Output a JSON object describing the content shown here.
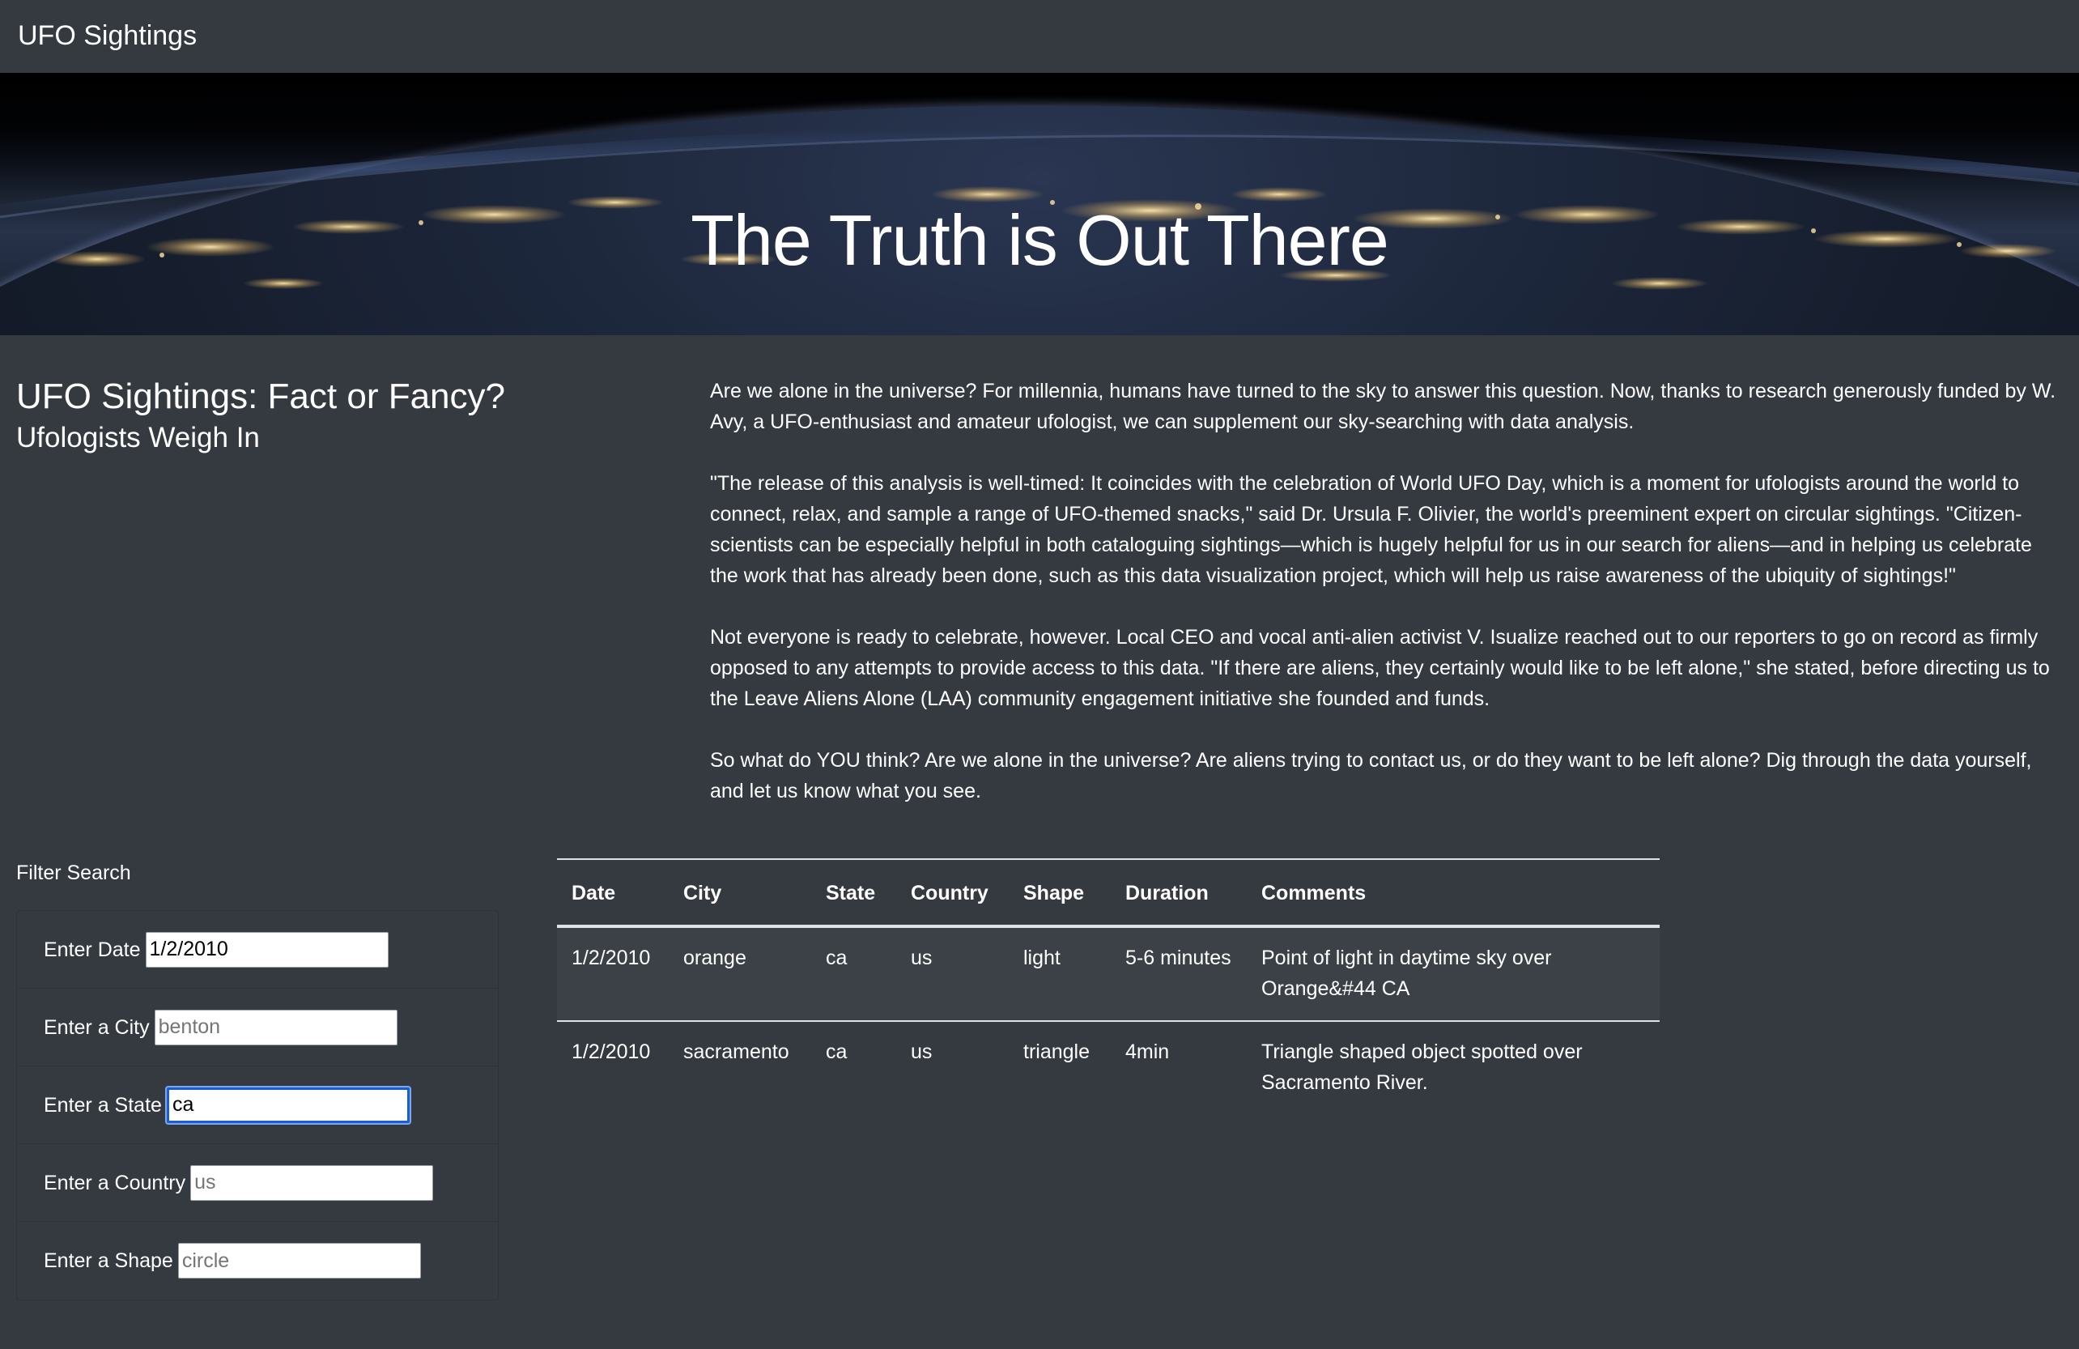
{
  "navbar": {
    "brand": "UFO Sightings"
  },
  "hero": {
    "title": "The Truth is Out There"
  },
  "intro": {
    "title": "UFO Sightings: Fact or Fancy?",
    "subtitle": "Ufologists Weigh In"
  },
  "article": {
    "paragraphs": [
      "Are we alone in the universe? For millennia, humans have turned to the sky to answer this question. Now, thanks to research generously funded by W. Avy, a UFO-enthusiast and amateur ufologist, we can supplement our sky-searching with data analysis.",
      "\"The release of this analysis is well-timed: It coincides with the celebration of World UFO Day, which is a moment for ufologists around the world to connect, relax, and sample a range of UFO-themed snacks,\" said Dr. Ursula F. Olivier, the world's preeminent expert on circular sightings. \"Citizen-scientists can be especially helpful in both cataloguing sightings—which is hugely helpful for us in our search for aliens—and in helping us celebrate the work that has already been done, such as this data visualization project, which will help us raise awareness of the ubiquity of sightings!\"",
      "Not everyone is ready to celebrate, however. Local CEO and vocal anti-alien activist V. Isualize reached out to our reporters to go on record as firmly opposed to any attempts to provide access to this data. \"If there are aliens, they certainly would like to be left alone,\" she stated, before directing us to the Leave Aliens Alone (LAA) community engagement initiative she founded and funds.",
      "So what do YOU think? Are we alone in the universe? Are aliens trying to contact us, or do they want to be left alone? Dig through the data yourself, and let us know what you see."
    ]
  },
  "filters": {
    "heading": "Filter Search",
    "date": {
      "label": "Enter Date",
      "value": "1/2/2010",
      "placeholder": ""
    },
    "city": {
      "label": "Enter a City",
      "value": "",
      "placeholder": "benton"
    },
    "state": {
      "label": "Enter a State",
      "value": "ca",
      "placeholder": ""
    },
    "country": {
      "label": "Enter a Country",
      "value": "",
      "placeholder": "us"
    },
    "shape": {
      "label": "Enter a Shape",
      "value": "",
      "placeholder": "circle"
    }
  },
  "table": {
    "headers": {
      "date": "Date",
      "city": "City",
      "state": "State",
      "country": "Country",
      "shape": "Shape",
      "duration": "Duration",
      "comments": "Comments"
    },
    "rows": [
      {
        "date": "1/2/2010",
        "city": "orange",
        "state": "ca",
        "country": "us",
        "shape": "light",
        "duration": "5-6 minutes",
        "comments": "Point of light in daytime sky over Orange&#44 CA"
      },
      {
        "date": "1/2/2010",
        "city": "sacramento",
        "state": "ca",
        "country": "us",
        "shape": "triangle",
        "duration": "4min",
        "comments": "Triangle shaped object spotted over Sacramento River."
      }
    ]
  }
}
